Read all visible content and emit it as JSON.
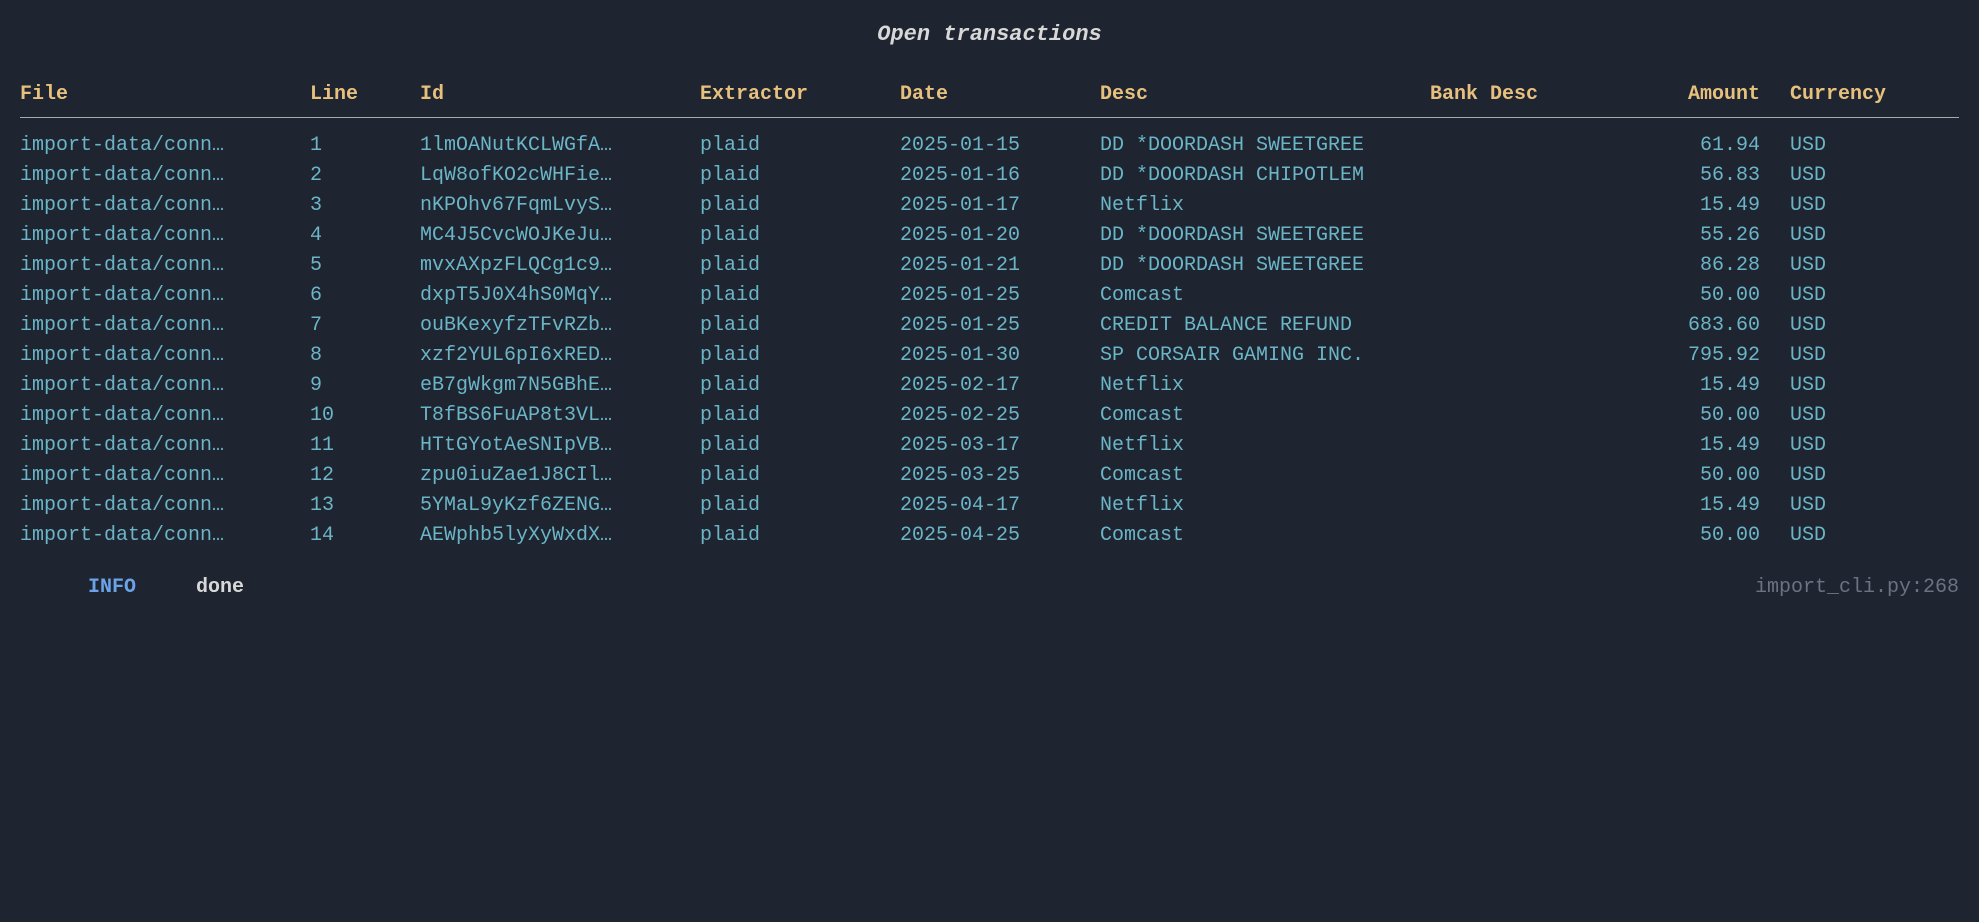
{
  "title": "Open transactions",
  "columns": {
    "file": "File",
    "line": "Line",
    "id": "Id",
    "extractor": "Extractor",
    "date": "Date",
    "desc": "Desc",
    "bank_desc": "Bank Desc",
    "amount": "Amount",
    "currency": "Currency"
  },
  "rows": [
    {
      "file": "import-data/conn…",
      "line": "1",
      "id": "1lmOANutKCLWGfA…",
      "extractor": "plaid",
      "date": "2025-01-15",
      "desc": "DD *DOORDASH SWEETGREE",
      "bank_desc": "",
      "amount": "61.94",
      "currency": "USD"
    },
    {
      "file": "import-data/conn…",
      "line": "2",
      "id": "LqW8ofKO2cWHFie…",
      "extractor": "plaid",
      "date": "2025-01-16",
      "desc": "DD *DOORDASH CHIPOTLEM",
      "bank_desc": "",
      "amount": "56.83",
      "currency": "USD"
    },
    {
      "file": "import-data/conn…",
      "line": "3",
      "id": "nKPOhv67FqmLvyS…",
      "extractor": "plaid",
      "date": "2025-01-17",
      "desc": "Netflix",
      "bank_desc": "",
      "amount": "15.49",
      "currency": "USD"
    },
    {
      "file": "import-data/conn…",
      "line": "4",
      "id": "MC4J5CvcWOJKeJu…",
      "extractor": "plaid",
      "date": "2025-01-20",
      "desc": "DD *DOORDASH SWEETGREE",
      "bank_desc": "",
      "amount": "55.26",
      "currency": "USD"
    },
    {
      "file": "import-data/conn…",
      "line": "5",
      "id": "mvxAXpzFLQCg1c9…",
      "extractor": "plaid",
      "date": "2025-01-21",
      "desc": "DD *DOORDASH SWEETGREE",
      "bank_desc": "",
      "amount": "86.28",
      "currency": "USD"
    },
    {
      "file": "import-data/conn…",
      "line": "6",
      "id": "dxpT5J0X4hS0MqY…",
      "extractor": "plaid",
      "date": "2025-01-25",
      "desc": "Comcast",
      "bank_desc": "",
      "amount": "50.00",
      "currency": "USD"
    },
    {
      "file": "import-data/conn…",
      "line": "7",
      "id": "ouBKexyfzTFvRZb…",
      "extractor": "plaid",
      "date": "2025-01-25",
      "desc": "CREDIT BALANCE REFUND",
      "bank_desc": "",
      "amount": "683.60",
      "currency": "USD"
    },
    {
      "file": "import-data/conn…",
      "line": "8",
      "id": "xzf2YUL6pI6xRED…",
      "extractor": "plaid",
      "date": "2025-01-30",
      "desc": "SP CORSAIR GAMING INC.",
      "bank_desc": "",
      "amount": "795.92",
      "currency": "USD"
    },
    {
      "file": "import-data/conn…",
      "line": "9",
      "id": "eB7gWkgm7N5GBhE…",
      "extractor": "plaid",
      "date": "2025-02-17",
      "desc": "Netflix",
      "bank_desc": "",
      "amount": "15.49",
      "currency": "USD"
    },
    {
      "file": "import-data/conn…",
      "line": "10",
      "id": "T8fBS6FuAP8t3VL…",
      "extractor": "plaid",
      "date": "2025-02-25",
      "desc": "Comcast",
      "bank_desc": "",
      "amount": "50.00",
      "currency": "USD"
    },
    {
      "file": "import-data/conn…",
      "line": "11",
      "id": "HTtGYotAeSNIpVB…",
      "extractor": "plaid",
      "date": "2025-03-17",
      "desc": "Netflix",
      "bank_desc": "",
      "amount": "15.49",
      "currency": "USD"
    },
    {
      "file": "import-data/conn…",
      "line": "12",
      "id": "zpu0iuZae1J8CIl…",
      "extractor": "plaid",
      "date": "2025-03-25",
      "desc": "Comcast",
      "bank_desc": "",
      "amount": "50.00",
      "currency": "USD"
    },
    {
      "file": "import-data/conn…",
      "line": "13",
      "id": "5YMaL9yKzf6ZENG…",
      "extractor": "plaid",
      "date": "2025-04-17",
      "desc": "Netflix",
      "bank_desc": "",
      "amount": "15.49",
      "currency": "USD"
    },
    {
      "file": "import-data/conn…",
      "line": "14",
      "id": "AEWphb5lyXyWxdX…",
      "extractor": "plaid",
      "date": "2025-04-25",
      "desc": "Comcast",
      "bank_desc": "",
      "amount": "50.00",
      "currency": "USD"
    }
  ],
  "footer": {
    "info": "INFO",
    "done": "done",
    "source": "import_cli.py:268"
  }
}
